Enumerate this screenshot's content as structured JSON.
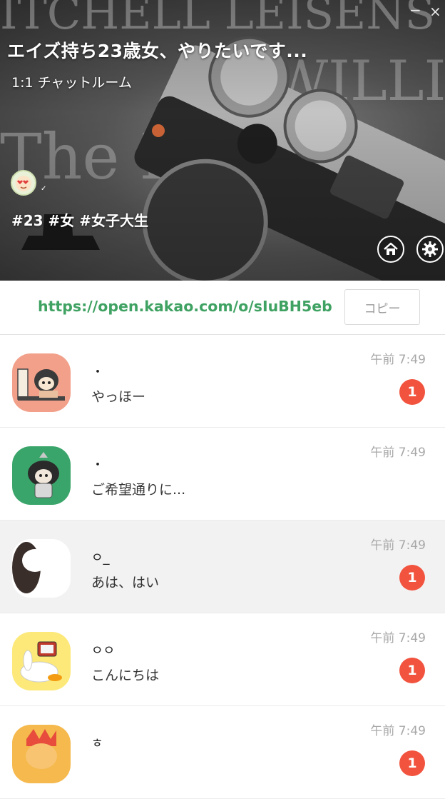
{
  "window": {
    "minimize_label": "−",
    "close_label": "×"
  },
  "header": {
    "title": "エイズ持ち23歳女、やりたいです...",
    "room_type": "1:1 チャットルーム",
    "tags": "#23 #女 #女子大生",
    "owner_mark": "✓",
    "home_icon": "home-icon",
    "settings_icon": "gear-icon"
  },
  "link": {
    "url": "https://open.kakao.com/o/sIuBH5eb",
    "copy_label": "コピー"
  },
  "chats": [
    {
      "name": "・",
      "message": "やっほー",
      "time": "午前 7:49",
      "unread": "1",
      "avatar_bg": "#f2a08a"
    },
    {
      "name": "・",
      "message": "ご希望通りに...",
      "time": "午前 7:49",
      "unread": "",
      "avatar_bg": "#3aa56a"
    },
    {
      "name": "ㅇ_",
      "message": "あは、はい",
      "time": "午前 7:49",
      "unread": "1",
      "avatar_bg": "#ffffff"
    },
    {
      "name": "ㅇㅇ",
      "message": "こんにちは",
      "time": "午前 7:49",
      "unread": "1",
      "avatar_bg": "#fce97a"
    },
    {
      "name": "ㅎ",
      "message": "",
      "time": "午前 7:49",
      "unread": "1",
      "avatar_bg": "#f5b94d"
    }
  ],
  "colors": {
    "link": "#3fa262",
    "badge": "#f2533e",
    "selected_row": "#f2f2f2"
  }
}
